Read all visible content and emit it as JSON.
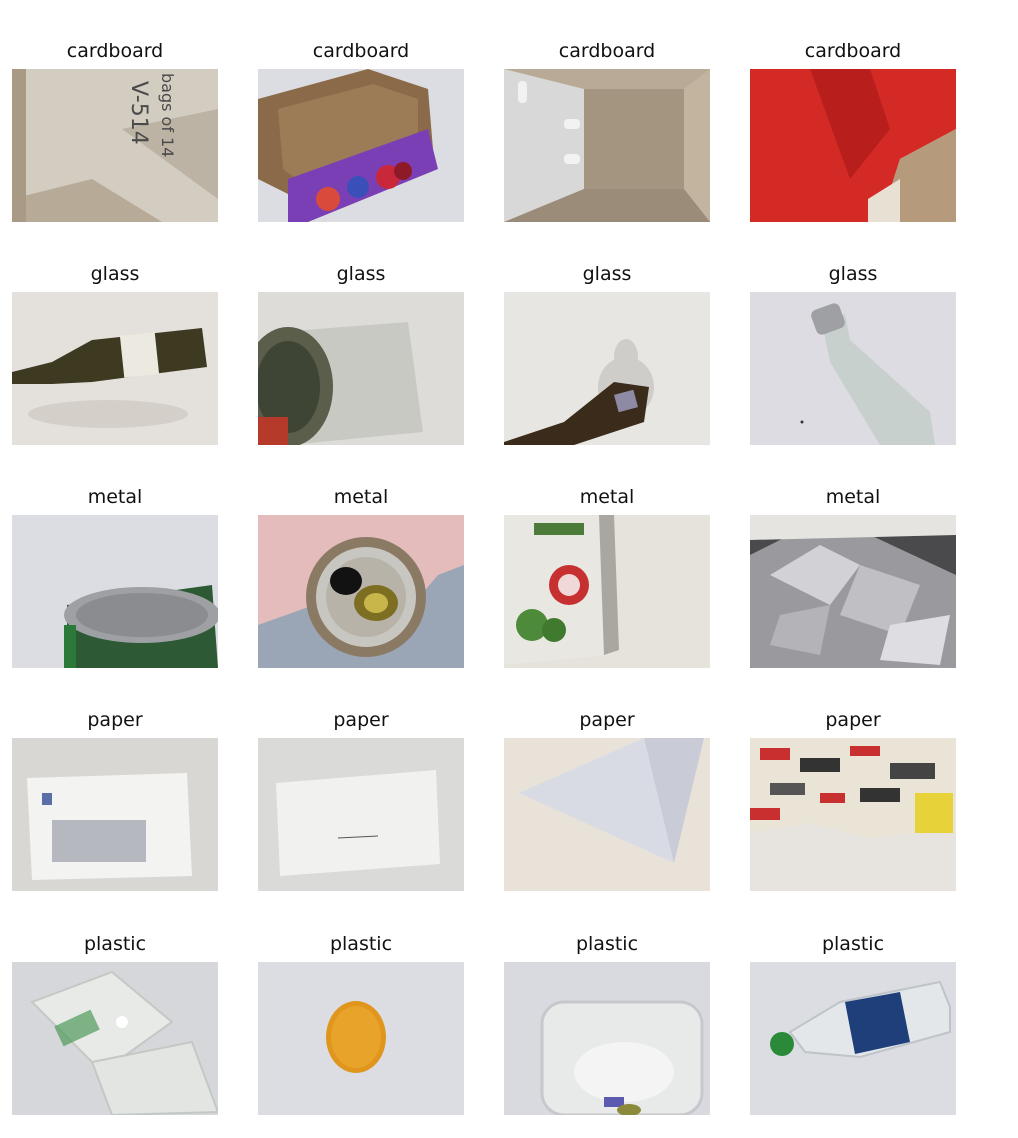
{
  "grid": {
    "rows": [
      {
        "label": "cardboard",
        "items": [
          {
            "title": "cardboard",
            "photo": "cardboard-sheet-printed-text"
          },
          {
            "title": "cardboard",
            "photo": "purple-fruit-box"
          },
          {
            "title": "cardboard",
            "photo": "open-cardboard-box"
          },
          {
            "title": "cardboard",
            "photo": "red-cardboard-box"
          }
        ]
      },
      {
        "label": "glass",
        "items": [
          {
            "title": "glass",
            "photo": "brown-wine-bottle"
          },
          {
            "title": "glass",
            "photo": "glass-jar"
          },
          {
            "title": "glass",
            "photo": "dark-bottle-shadow"
          },
          {
            "title": "glass",
            "photo": "frosted-glass-bottle"
          }
        ]
      },
      {
        "label": "metal",
        "items": [
          {
            "title": "metal",
            "photo": "tin-can"
          },
          {
            "title": "metal",
            "photo": "soda-can-top"
          },
          {
            "title": "metal",
            "photo": "pea-can"
          },
          {
            "title": "metal",
            "photo": "aluminum-foil"
          }
        ]
      },
      {
        "label": "paper",
        "items": [
          {
            "title": "paper",
            "photo": "window-envelope"
          },
          {
            "title": "paper",
            "photo": "white-envelope"
          },
          {
            "title": "paper",
            "photo": "sheet-of-paper"
          },
          {
            "title": "paper",
            "photo": "printed-flyer"
          }
        ]
      },
      {
        "label": "plastic",
        "items": [
          {
            "title": "plastic",
            "photo": "clear-clamshell"
          },
          {
            "title": "plastic",
            "photo": "orange-lid"
          },
          {
            "title": "plastic",
            "photo": "plastic-container"
          },
          {
            "title": "plastic",
            "photo": "water-bottle"
          }
        ]
      }
    ]
  },
  "cardboard_print": {
    "code": "V-514",
    "bag_text": "bags of 14"
  }
}
